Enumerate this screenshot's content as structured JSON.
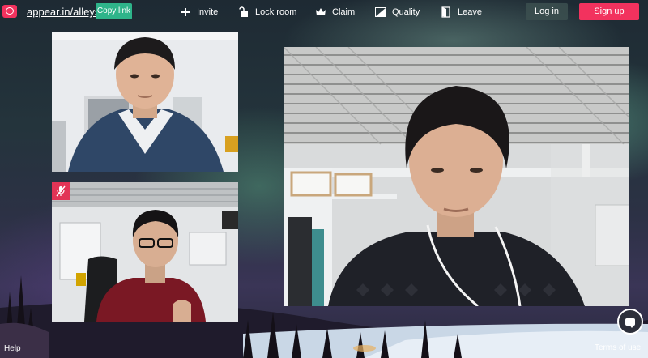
{
  "header": {
    "room_link": "appear.in/alleys",
    "copy_link_label": "Copy link",
    "menu": [
      {
        "label": "Invite",
        "icon": "plus-icon"
      },
      {
        "label": "Lock room",
        "icon": "unlock-icon"
      },
      {
        "label": "Claim",
        "icon": "crown-icon"
      },
      {
        "label": "Quality",
        "icon": "quality-icon"
      },
      {
        "label": "Leave",
        "icon": "door-icon"
      }
    ],
    "login_label": "Log in",
    "signup_label": "Sign up"
  },
  "videos": [
    {
      "participant": "participant-1",
      "muted": false
    },
    {
      "participant": "participant-2",
      "muted": true
    },
    {
      "participant": "participant-3",
      "muted": false
    }
  ],
  "footer": {
    "help_label": "Help",
    "terms_label": "Terms of use"
  },
  "colors": {
    "brand": "#f2325e",
    "copy_button": "#2eb48a",
    "mute_badge": "#e23456"
  }
}
